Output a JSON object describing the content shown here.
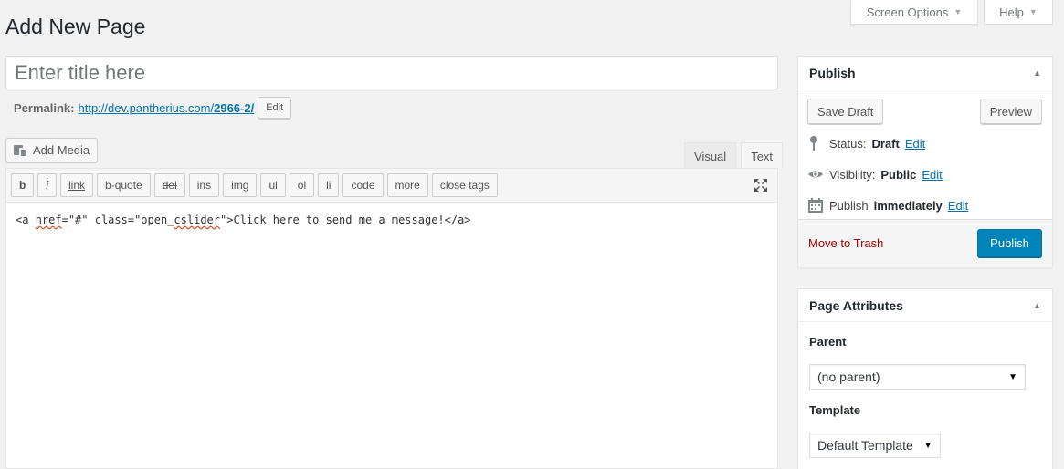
{
  "header": {
    "title": "Add New Page",
    "screen_options": "Screen Options",
    "help": "Help"
  },
  "post_title": {
    "placeholder": "Enter title here",
    "value": ""
  },
  "permalink": {
    "label": "Permalink:",
    "url_base": "http://dev.pantherius.com/",
    "url_slug": "2966-2/",
    "edit_label": "Edit"
  },
  "media": {
    "add_media_label": "Add Media"
  },
  "editor": {
    "tabs": [
      {
        "label": "Visual",
        "active": false
      },
      {
        "label": "Text",
        "active": true
      }
    ],
    "quicktags": [
      "b",
      "i",
      "link",
      "b-quote",
      "del",
      "ins",
      "img",
      "ul",
      "ol",
      "li",
      "code",
      "more",
      "close tags"
    ],
    "content": {
      "p1": "<a ",
      "p2": "href",
      "p3": "=\"#\" class=\"open_",
      "p4": "cslider",
      "p5": "\">Click here to send me a message!</a>"
    }
  },
  "publish": {
    "title": "Publish",
    "save_draft": "Save Draft",
    "preview": "Preview",
    "status_label": "Status:",
    "status_value": "Draft",
    "visibility_label": "Visibility:",
    "visibility_value": "Public",
    "publish_label": "Publish",
    "publish_value": "immediately",
    "edit_link": "Edit",
    "move_to_trash": "Move to Trash",
    "publish_button": "Publish"
  },
  "page_attributes": {
    "title": "Page Attributes",
    "parent_label": "Parent",
    "parent_value": "(no parent)",
    "template_label": "Template",
    "template_value": "Default Template"
  },
  "colors": {
    "primary_button": "#0085ba",
    "link": "#0073aa",
    "trash": "#aa0000"
  }
}
